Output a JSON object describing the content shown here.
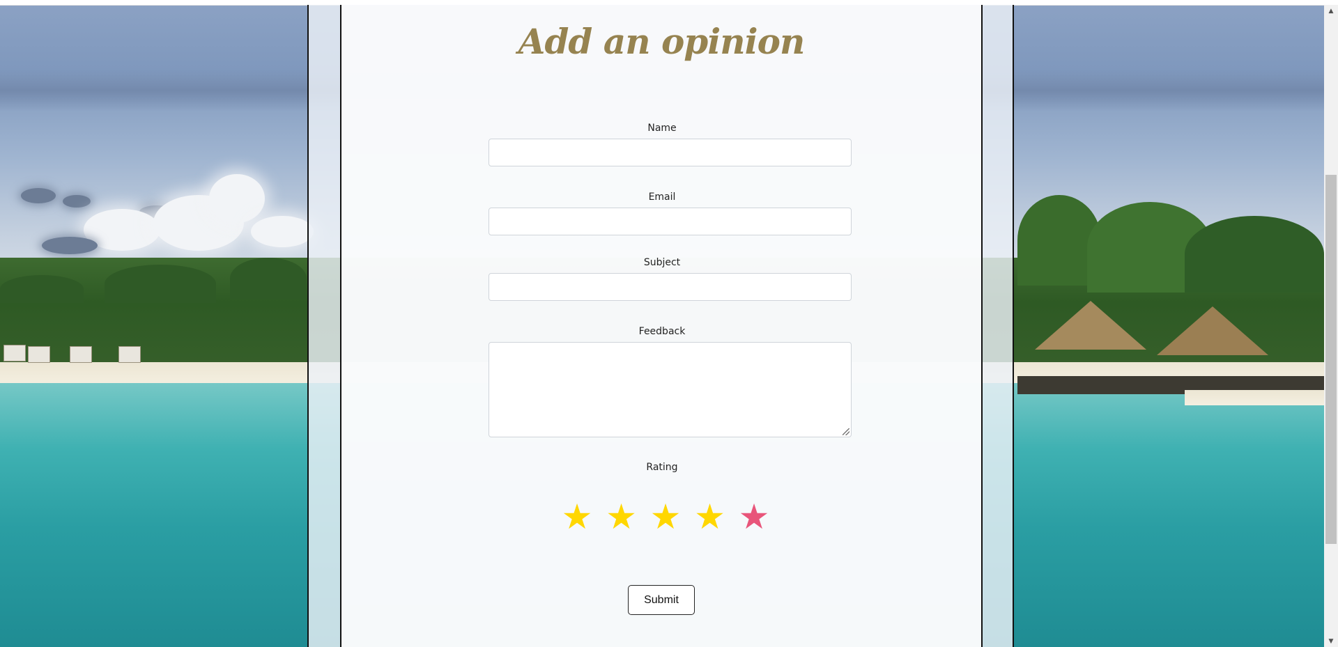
{
  "page": {
    "title": "Add an opinion"
  },
  "form": {
    "name_label": "Name",
    "email_label": "Email",
    "subject_label": "Subject",
    "feedback_label": "Feedback",
    "rating_label": "Rating",
    "name_value": "",
    "email_value": "",
    "subject_value": "",
    "feedback_value": "",
    "submit_label": "Submit"
  },
  "rating": {
    "stars": [
      {
        "glyph": "★",
        "color": "#ffd700"
      },
      {
        "glyph": "★",
        "color": "#ffd700"
      },
      {
        "glyph": "★",
        "color": "#ffd700"
      },
      {
        "glyph": "★",
        "color": "#ffd700"
      },
      {
        "glyph": "★",
        "color": "#e8557a"
      }
    ],
    "highlighted_star": 5
  },
  "colors": {
    "title": "#968350",
    "star_filled": "#ffd700",
    "star_hover": "#e8557a"
  }
}
